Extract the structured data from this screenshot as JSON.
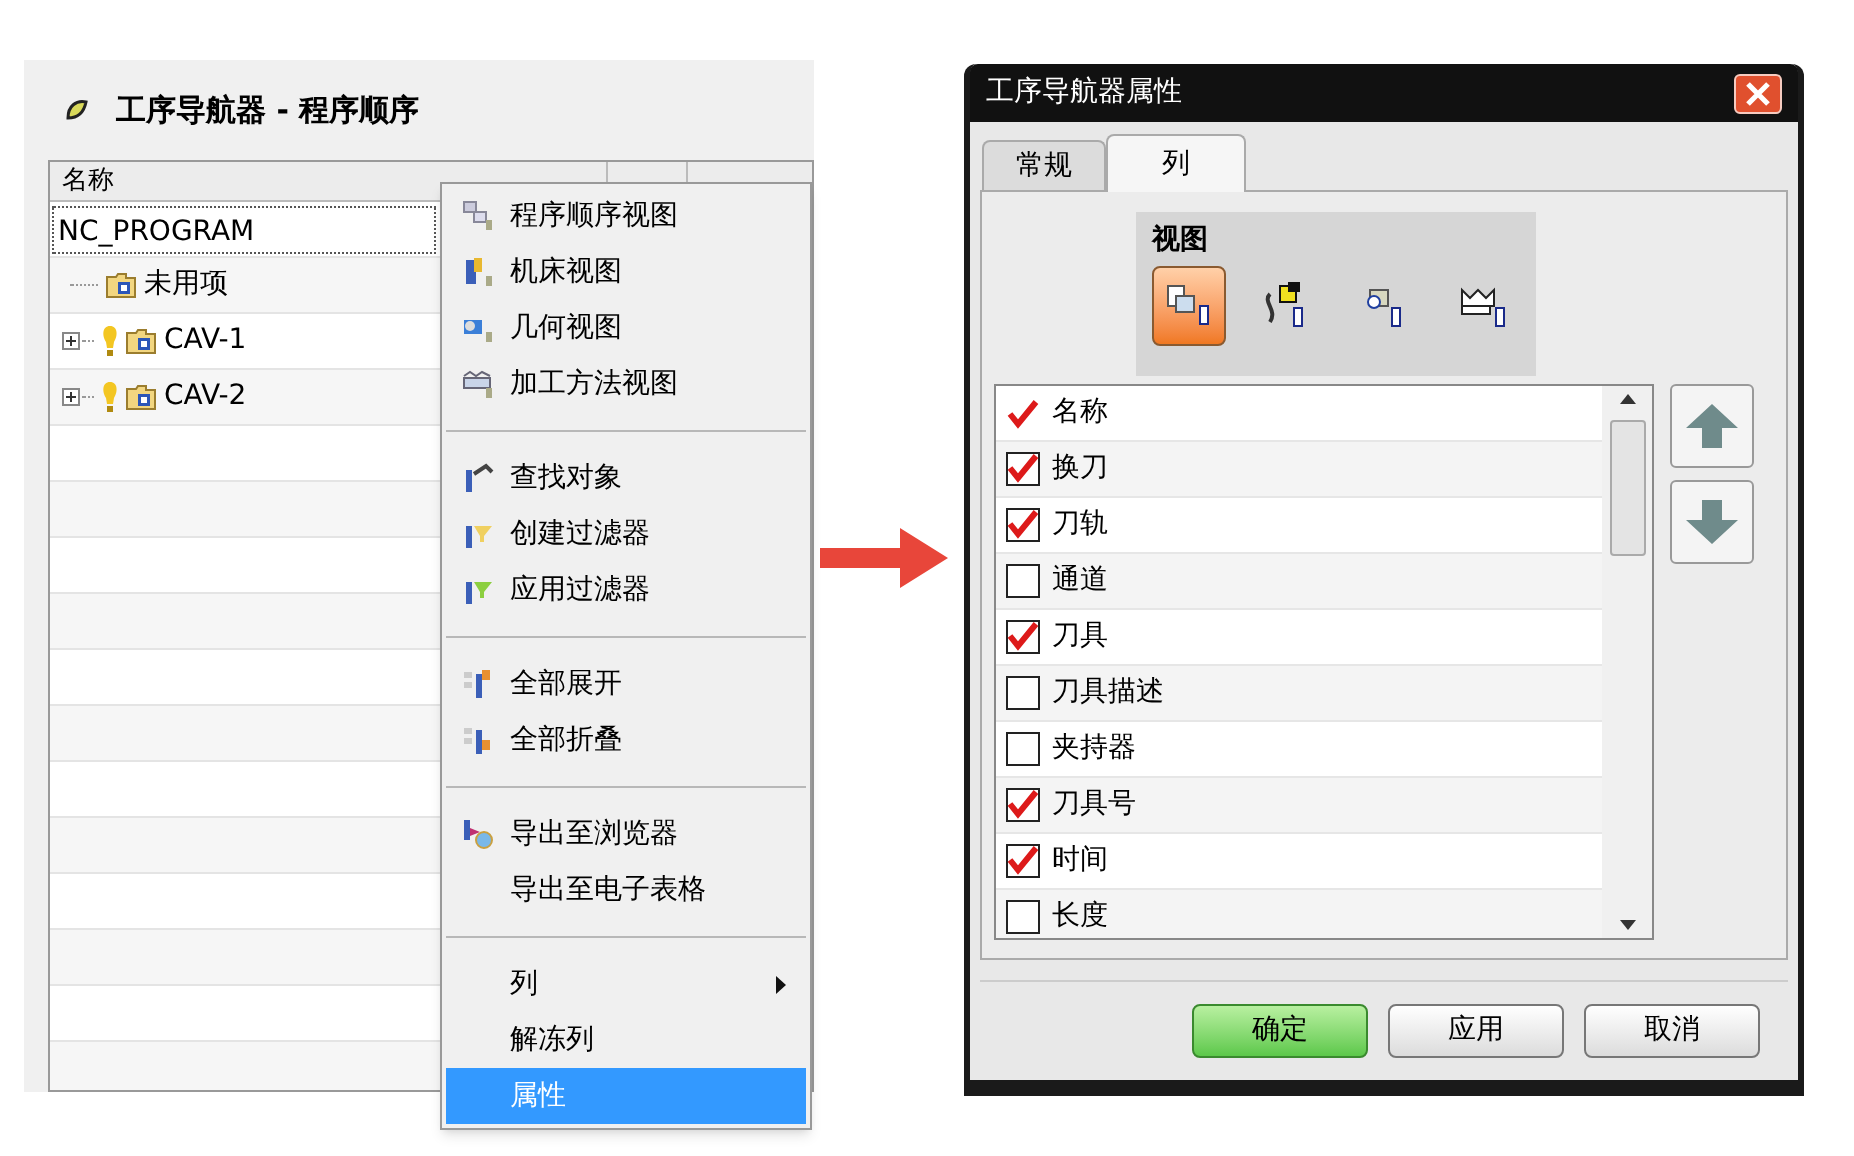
{
  "navigator": {
    "title": "工序导航器 - 程序顺序",
    "columns": [
      "名称"
    ],
    "rows": [
      {
        "label": "NC_PROGRAM",
        "kind": "root",
        "selected": true
      },
      {
        "label": "未用项",
        "kind": "group",
        "expandable": false
      },
      {
        "label": "CAV-1",
        "kind": "group",
        "expandable": true
      },
      {
        "label": "CAV-2",
        "kind": "group",
        "expandable": true
      }
    ]
  },
  "context_menu": {
    "groups": [
      [
        {
          "label": "程序顺序视图",
          "selected": false
        },
        {
          "label": "机床视图",
          "selected": false
        },
        {
          "label": "几何视图",
          "selected": false
        },
        {
          "label": "加工方法视图",
          "selected": false
        }
      ],
      [
        {
          "label": "查找对象",
          "selected": false
        },
        {
          "label": "创建过滤器",
          "selected": false
        },
        {
          "label": "应用过滤器",
          "selected": false
        }
      ],
      [
        {
          "label": "全部展开",
          "selected": false
        },
        {
          "label": "全部折叠",
          "selected": false
        }
      ],
      [
        {
          "label": "导出至浏览器",
          "selected": false
        },
        {
          "label": "导出至电子表格",
          "selected": false
        }
      ],
      [
        {
          "label": "列",
          "selected": false,
          "submenu": true
        },
        {
          "label": "解冻列",
          "selected": false
        },
        {
          "label": "属性",
          "selected": true
        }
      ]
    ]
  },
  "dialog": {
    "title": "工序导航器属性",
    "tabs": [
      {
        "label": "常规",
        "selected": false
      },
      {
        "label": "列",
        "selected": true
      }
    ],
    "view_group": {
      "title": "视图",
      "views": [
        {
          "selected": true
        },
        {
          "selected": false
        },
        {
          "selected": false
        },
        {
          "selected": false
        }
      ]
    },
    "column_list": [
      {
        "label": "名称",
        "kind": "fixed",
        "checked": true
      },
      {
        "label": "换刀",
        "kind": "checkbox",
        "checked": true
      },
      {
        "label": "刀轨",
        "kind": "checkbox",
        "checked": true
      },
      {
        "label": "通道",
        "kind": "checkbox",
        "checked": false
      },
      {
        "label": "刀具",
        "kind": "checkbox",
        "checked": true
      },
      {
        "label": "刀具描述",
        "kind": "checkbox",
        "checked": false
      },
      {
        "label": "夹持器",
        "kind": "checkbox",
        "checked": false
      },
      {
        "label": "刀具号",
        "kind": "checkbox",
        "checked": true
      },
      {
        "label": "时间",
        "kind": "checkbox",
        "checked": true
      },
      {
        "label": "长度",
        "kind": "checkbox",
        "checked": false
      }
    ],
    "buttons": [
      {
        "label": "确定",
        "kind": "primary"
      },
      {
        "label": "应用",
        "kind": "normal"
      },
      {
        "label": "取消",
        "kind": "normal"
      }
    ]
  }
}
